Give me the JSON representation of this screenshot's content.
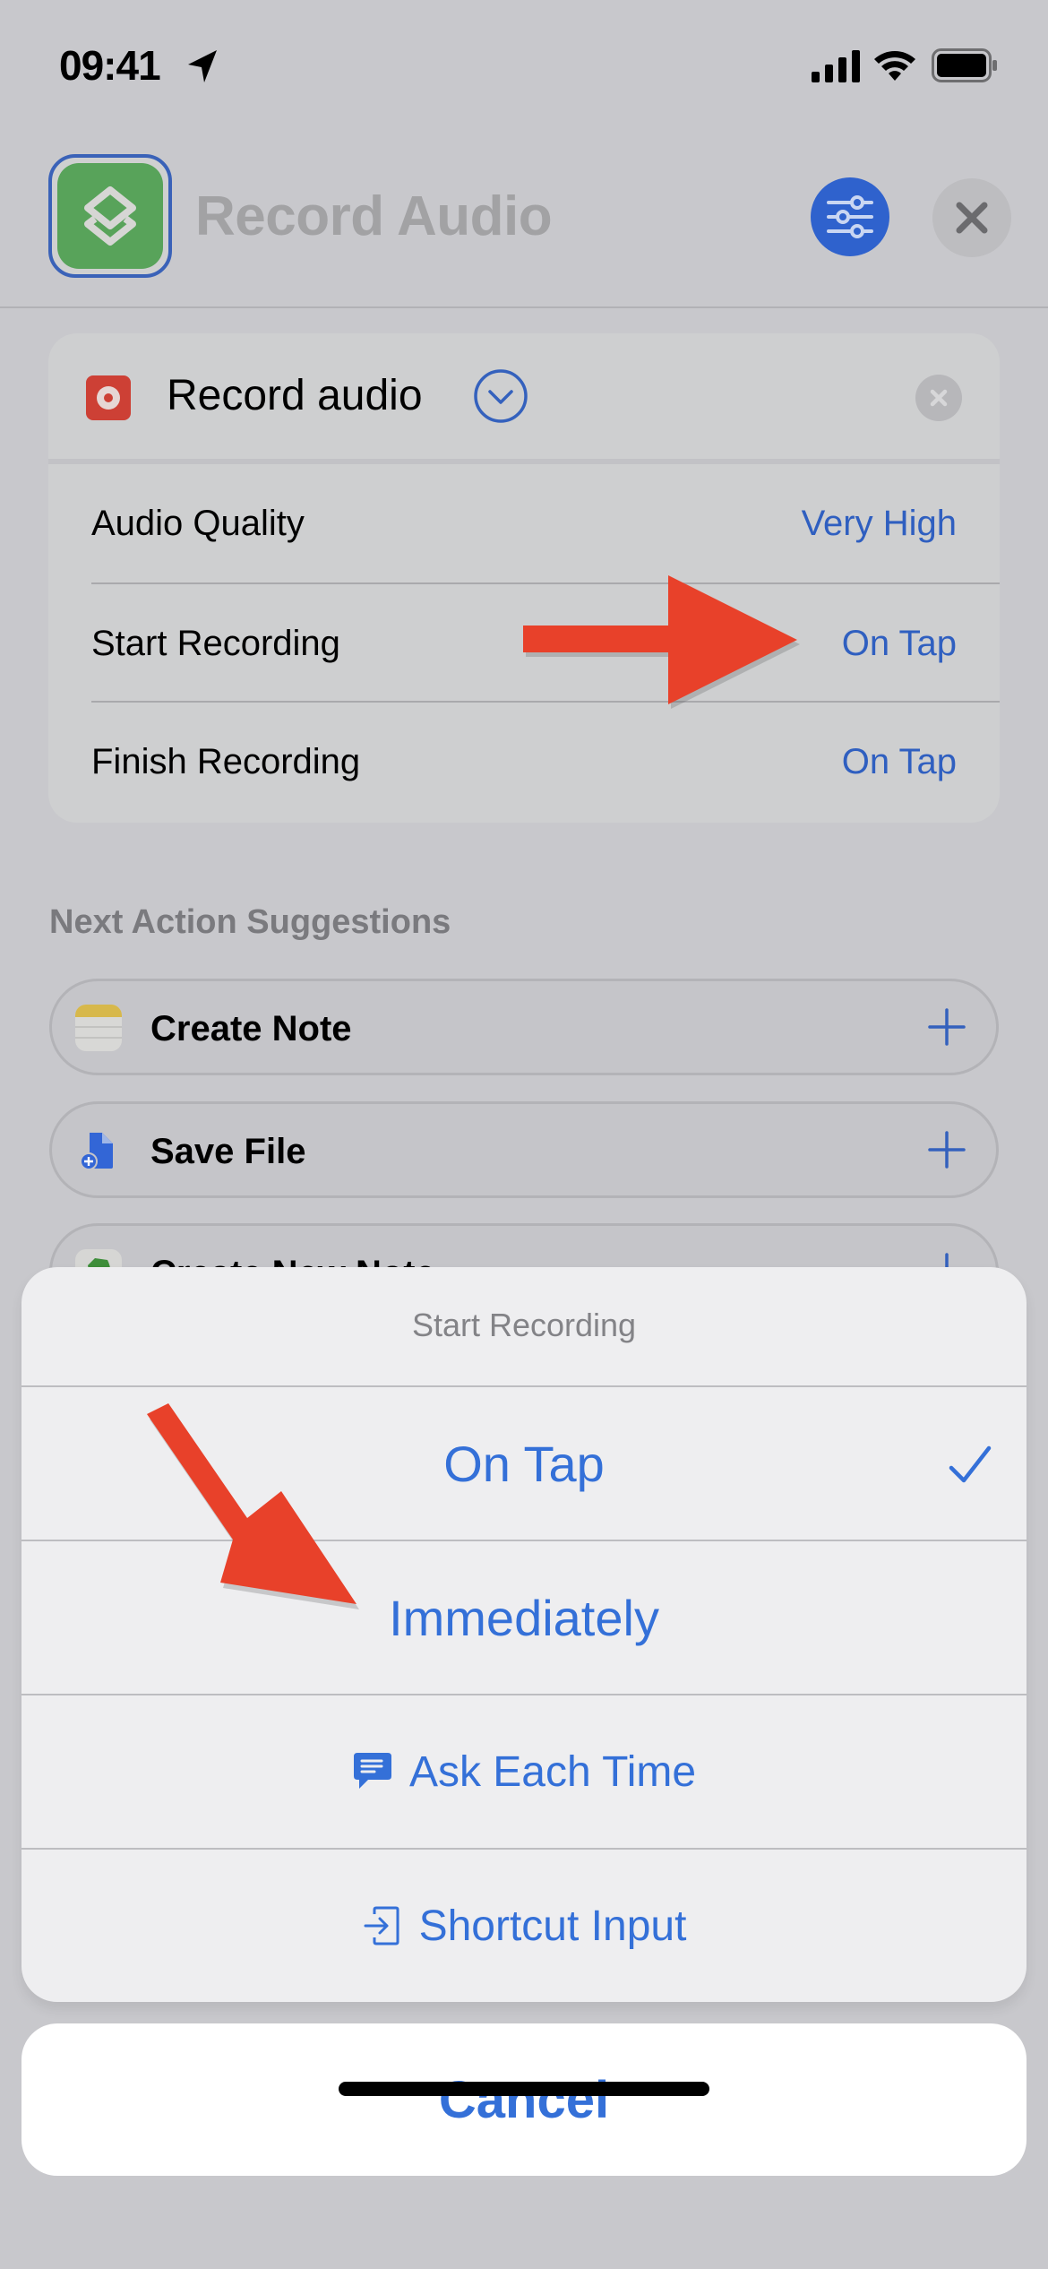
{
  "status_bar": {
    "time": "09:41"
  },
  "header": {
    "title": "Record Audio"
  },
  "action_card": {
    "title": "Record audio",
    "params": [
      {
        "label": "Audio Quality",
        "value": "Very High"
      },
      {
        "label": "Start Recording",
        "value": "On Tap"
      },
      {
        "label": "Finish Recording",
        "value": "On Tap"
      }
    ]
  },
  "suggestions": {
    "heading": "Next Action Suggestions",
    "items": [
      {
        "label": "Create Note",
        "icon": "notes-icon"
      },
      {
        "label": "Save File",
        "icon": "file-add-icon"
      },
      {
        "label": "Create New Note",
        "icon": "evernote-icon"
      }
    ]
  },
  "action_sheet": {
    "title": "Start Recording",
    "selected": "On Tap",
    "options": [
      {
        "label": "On Tap",
        "icon": null,
        "checked": true
      },
      {
        "label": "Immediately",
        "icon": null,
        "checked": false
      },
      {
        "label": "Ask Each Time",
        "icon": "chat-bubble-icon",
        "checked": false
      },
      {
        "label": "Shortcut Input",
        "icon": "input-icon",
        "checked": false
      }
    ],
    "cancel_label": "Cancel"
  },
  "colors": {
    "accent": "#3470d8",
    "annotation_arrow": "#e8412a",
    "app_icon": "#58a35a",
    "record_icon": "#cd4035"
  }
}
